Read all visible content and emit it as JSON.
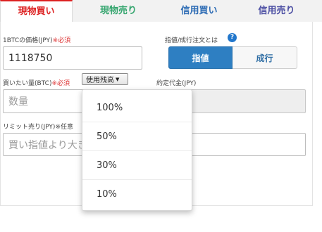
{
  "tabs": [
    {
      "label": "現物買い",
      "color": "#d22222"
    },
    {
      "label": "現物売り",
      "color": "#34a56e"
    },
    {
      "label": "信用買い",
      "color": "#2f6db5"
    },
    {
      "label": "信用売り",
      "color": "#4c4fa3"
    }
  ],
  "price": {
    "label": "1BTCの価格(JPY)",
    "required": "※必須",
    "value": "1118750"
  },
  "order_type": {
    "label": "指値/成行注文とは",
    "help_icon": "question-circle-icon",
    "limit": "指値",
    "market": "成行",
    "selected": "指値"
  },
  "amount": {
    "label": "買いたい量(BTC)",
    "required": "※必須",
    "placeholder": "数量",
    "balance_button": "使用残高"
  },
  "contract": {
    "label": "約定代金(JPY)",
    "value": ""
  },
  "limit_sell": {
    "label": "リミット売り(JPY)",
    "optional": "※任意",
    "placeholder": "買い指値より大き"
  },
  "balance_menu": {
    "options": [
      "100%",
      "50%",
      "30%",
      "10%"
    ]
  },
  "colors": {
    "accent": "#2e7fc2",
    "required": "#dd3333"
  }
}
